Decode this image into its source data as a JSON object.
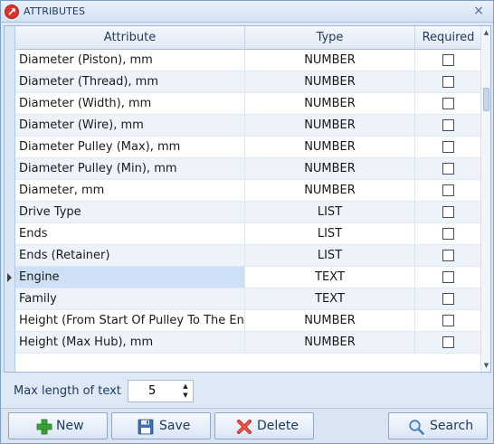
{
  "window": {
    "title": "ATTRIBUTES",
    "close_glyph": "×"
  },
  "grid": {
    "columns": [
      "Attribute",
      "Type",
      "Required"
    ],
    "rows": [
      {
        "attribute": "Diameter (Piston), mm",
        "type": "NUMBER",
        "required": false
      },
      {
        "attribute": "Diameter (Thread), mm",
        "type": "NUMBER",
        "required": false
      },
      {
        "attribute": "Diameter (Width), mm",
        "type": "NUMBER",
        "required": false
      },
      {
        "attribute": "Diameter (Wire), mm",
        "type": "NUMBER",
        "required": false
      },
      {
        "attribute": "Diameter Pulley (Max), mm",
        "type": "NUMBER",
        "required": false
      },
      {
        "attribute": "Diameter Pulley (Min), mm",
        "type": "NUMBER",
        "required": false
      },
      {
        "attribute": "Diameter, mm",
        "type": "NUMBER",
        "required": false
      },
      {
        "attribute": "Drive Type",
        "type": "LIST",
        "required": false
      },
      {
        "attribute": "Ends",
        "type": "LIST",
        "required": false
      },
      {
        "attribute": "Ends (Retainer)",
        "type": "LIST",
        "required": false
      },
      {
        "attribute": "Engine",
        "type": "TEXT",
        "required": false
      },
      {
        "attribute": "Family",
        "type": "TEXT",
        "required": false
      },
      {
        "attribute": "Height (From Start Of Pulley To The En",
        "type": "NUMBER",
        "required": false
      },
      {
        "attribute": "Height (Max Hub), mm",
        "type": "NUMBER",
        "required": false
      }
    ],
    "selected_row": 10,
    "scroll_up_glyph": "▲",
    "scroll_down_glyph": "▼"
  },
  "options": {
    "max_length_label": "Max length of text",
    "max_length_value": "5",
    "spin_up_glyph": "▲",
    "spin_down_glyph": "▼"
  },
  "toolbar": {
    "new_label": "New",
    "save_label": "Save",
    "delete_label": "Delete",
    "search_label": "Search",
    "icons": {
      "new": "plus-icon",
      "save": "floppy-disk-icon",
      "delete": "delete-x-icon",
      "search": "magnifier-icon"
    }
  },
  "colors": {
    "accent": "#1e395b",
    "selection": "#cde0f6",
    "app_icon": "#e0312a"
  }
}
